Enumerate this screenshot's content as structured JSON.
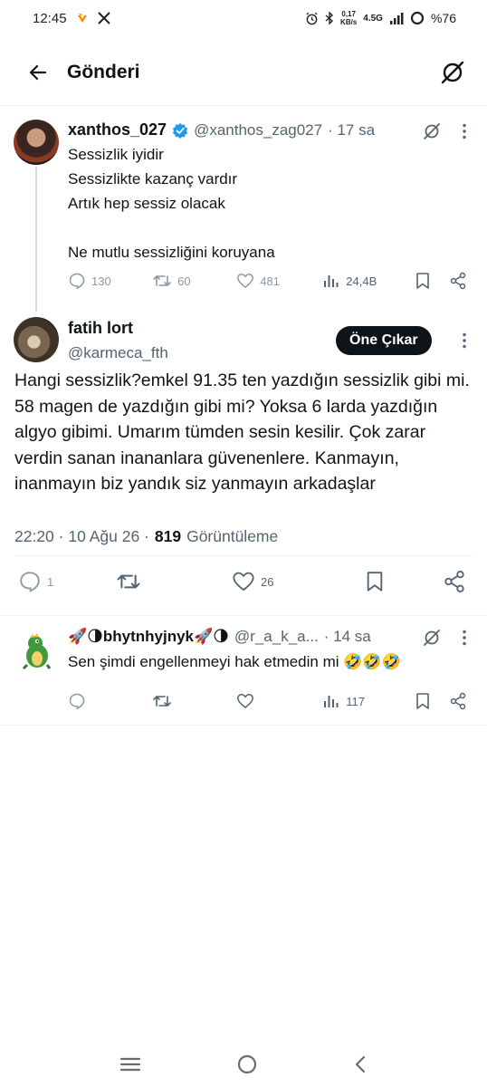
{
  "status_bar": {
    "time": "12:45",
    "speed_value": "0,17",
    "speed_unit": "KB/s",
    "network": "4.5G",
    "battery": "%76"
  },
  "header": {
    "title": "Gönderi"
  },
  "parent_tweet": {
    "display_name": "xanthos_027",
    "handle": "@xanthos_zag027",
    "time": "· 17 sa",
    "text": "Sessizlik iyidir\nSessizlikte kazanç vardır\nArtık hep sessiz olacak\n\nNe mutlu sessizliğini koruyana",
    "replies": "130",
    "reposts": "60",
    "likes": "481",
    "views": "24,4B"
  },
  "main_tweet": {
    "display_name": "fatih lort",
    "handle": "@karmeca_fth",
    "highlight_button": "Öne Çıkar",
    "text": "Hangi sessizlik?emkel 91.35 ten yazdığın sessizlik gibi mi. 58 magen de yazdığın gibi mi? Yoksa 6 larda yazdığın algyo gibimi. Umarım tümden sesin kesilir. Çok zarar verdin sanan inananlara güvenenlere. Kanmayın, inanmayın biz yandık siz yanmayın arkadaşlar",
    "timestamp": "22:20 · 10 Ağu 26 ·",
    "views_count": "819",
    "views_label": "Görüntüleme",
    "replies": "1",
    "likes": "26"
  },
  "reply_tweet": {
    "display_name": "🚀🌗bhytnhyjnyk🚀🌗",
    "handle": "@r_a_k_a...",
    "time": "· 14 sa",
    "text": "Sen şimdi engellenmeyi hak etmedin mi 🤣🤣🤣",
    "views": "117"
  },
  "colors": {
    "verified": "#1d9bf0",
    "muted_text": "#536471",
    "action_icon": "#8b98a5",
    "pill_bg": "#0f1419"
  }
}
